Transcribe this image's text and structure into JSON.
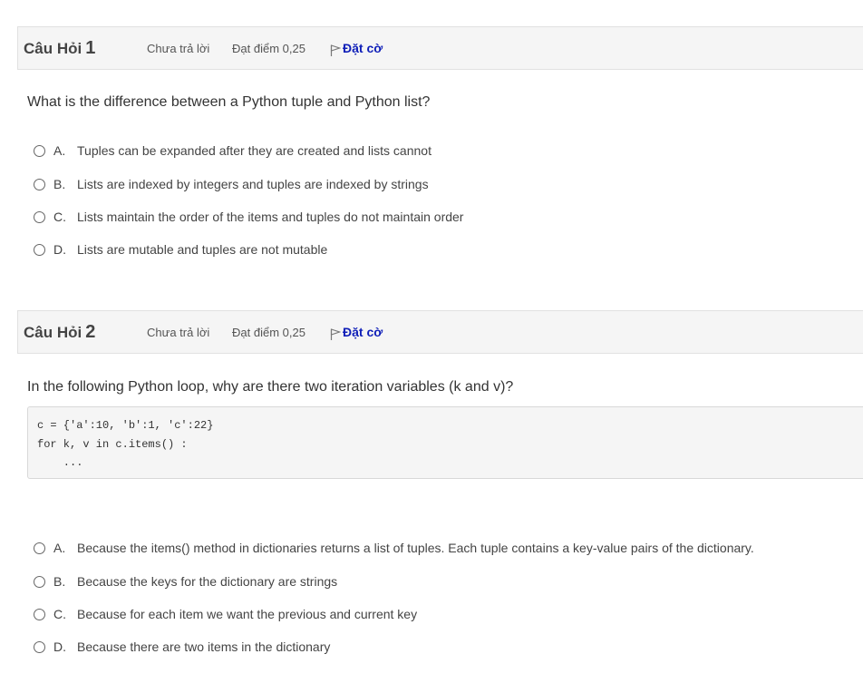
{
  "questions": [
    {
      "title": "Câu Hỏi",
      "number": "1",
      "state": "Chưa trả lời",
      "grade": "Đạt điểm 0,25",
      "flag_label": "Đặt cờ",
      "text": "What is the difference between a Python tuple and Python list?",
      "options": [
        {
          "letter": "A.",
          "text": "Tuples can be expanded after they are created and lists cannot"
        },
        {
          "letter": "B.",
          "text": "Lists are indexed by integers and tuples are indexed by strings"
        },
        {
          "letter": "C.",
          "text": "Lists maintain the order of the items and tuples do not maintain order"
        },
        {
          "letter": "D.",
          "text": "Lists are mutable and tuples are not mutable"
        }
      ]
    },
    {
      "title": "Câu Hỏi",
      "number": "2",
      "state": "Chưa trả lời",
      "grade": "Đạt điểm 0,25",
      "flag_label": "Đặt cờ",
      "text": "In the following Python loop, why are there two iteration variables (k and v)?",
      "code": "c = {'a':10, 'b':1, 'c':22}\nfor k, v in c.items() :\n    ...",
      "options": [
        {
          "letter": "A.",
          "text": "Because the items() method in dictionaries returns a list of tuples. Each tuple contains a key-value pairs of the dictionary."
        },
        {
          "letter": "B.",
          "text": "Because the keys for the dictionary are strings"
        },
        {
          "letter": "C.",
          "text": "Because for each item we want the previous and current key"
        },
        {
          "letter": "D.",
          "text": "Because there are two items in the dictionary"
        }
      ]
    }
  ]
}
